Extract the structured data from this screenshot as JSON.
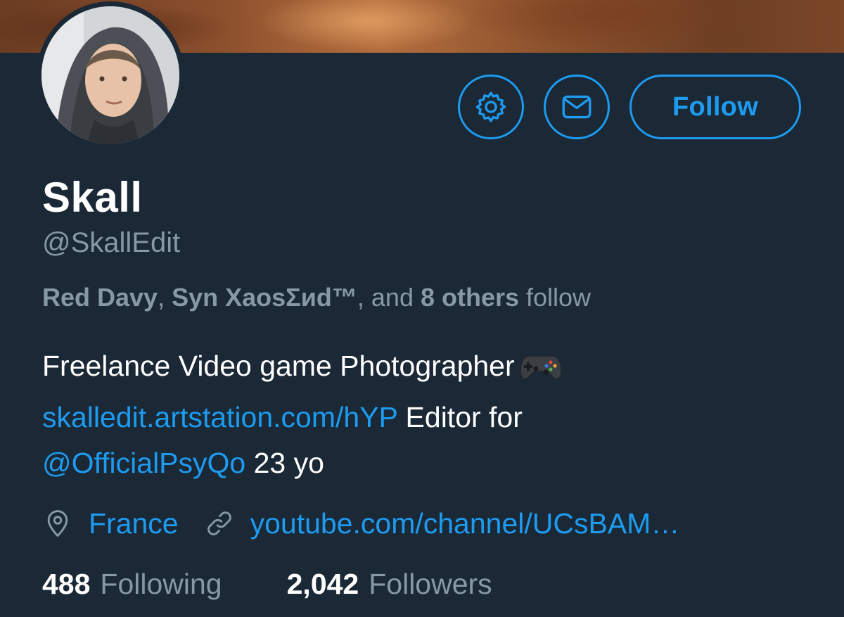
{
  "profile": {
    "name": "Skall",
    "handle": "@SkallEdit",
    "followed_by": {
      "user1": "Red Davy",
      "sep1": ", ",
      "user2": "Syn XaosΣиd™",
      "sep2": ", and ",
      "others": "8 others",
      "suffix": " follow"
    },
    "bio": {
      "text1": "Freelance Video game Photographer",
      "emoji": "gamepad-icon",
      "link1": "skalledit.artstation.com/hYP",
      "text2": " Editor for",
      "mention": "@OfficialPsyQo",
      "text3": " 23 yo"
    },
    "location": "France",
    "website": "youtube.com/channel/UCsBAM…"
  },
  "actions": {
    "settings_icon": "gear-icon",
    "message_icon": "envelope-icon",
    "follow_label": "Follow"
  },
  "stats": {
    "following_count": "488",
    "following_label": "Following",
    "followers_count": "2,042",
    "followers_label": "Followers"
  },
  "colors": {
    "background": "#1b2836",
    "accent": "#1d9bf0",
    "secondary_text": "#8899a6",
    "primary_text": "#ffffff"
  }
}
